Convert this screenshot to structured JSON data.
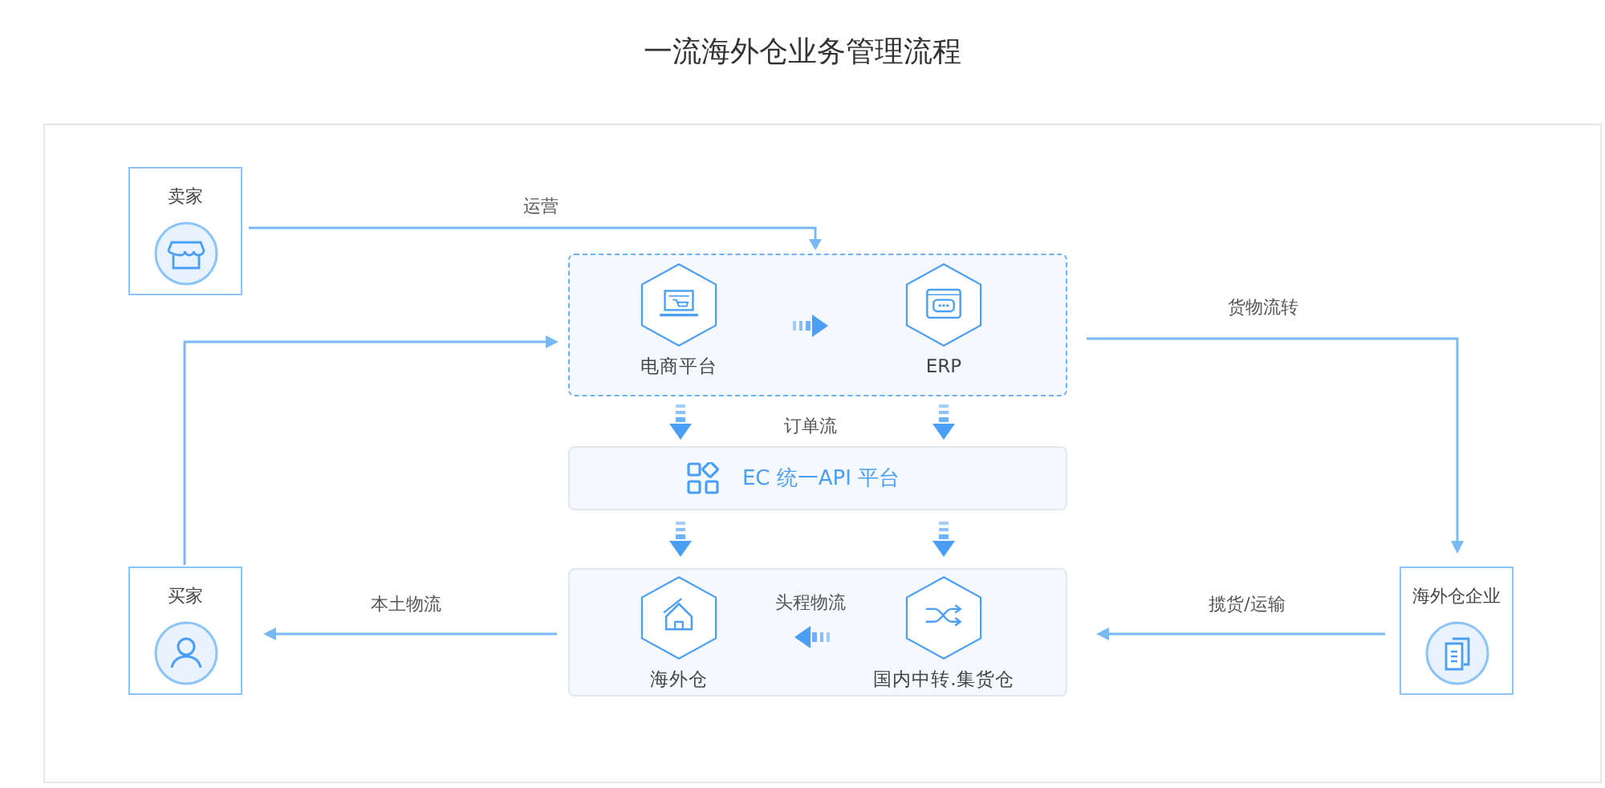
{
  "title": "一流海外仓业务管理流程",
  "actors": [
    {
      "label": "卖家",
      "kind": "store"
    },
    {
      "label": "买家",
      "kind": "person"
    },
    {
      "label": "海外仓企业",
      "kind": "documents"
    }
  ],
  "platform_group": {
    "nodes": [
      {
        "label": "电商平台",
        "kind": "laptop"
      },
      {
        "label": "ERP",
        "kind": "window"
      }
    ]
  },
  "api_bar": {
    "label": "EC 统一API 平台"
  },
  "warehouse_group": {
    "nodes": [
      {
        "label": "海外仓",
        "kind": "house"
      },
      {
        "label": "国内中转.集货仓",
        "kind": "shuffle"
      }
    ]
  },
  "flows": [
    {
      "label": "运营"
    },
    {
      "label": "货物流转"
    },
    {
      "label": "订单流"
    },
    {
      "label": "本土物流"
    },
    {
      "label": "头程物流"
    },
    {
      "label": "揽货/运输"
    }
  ]
}
